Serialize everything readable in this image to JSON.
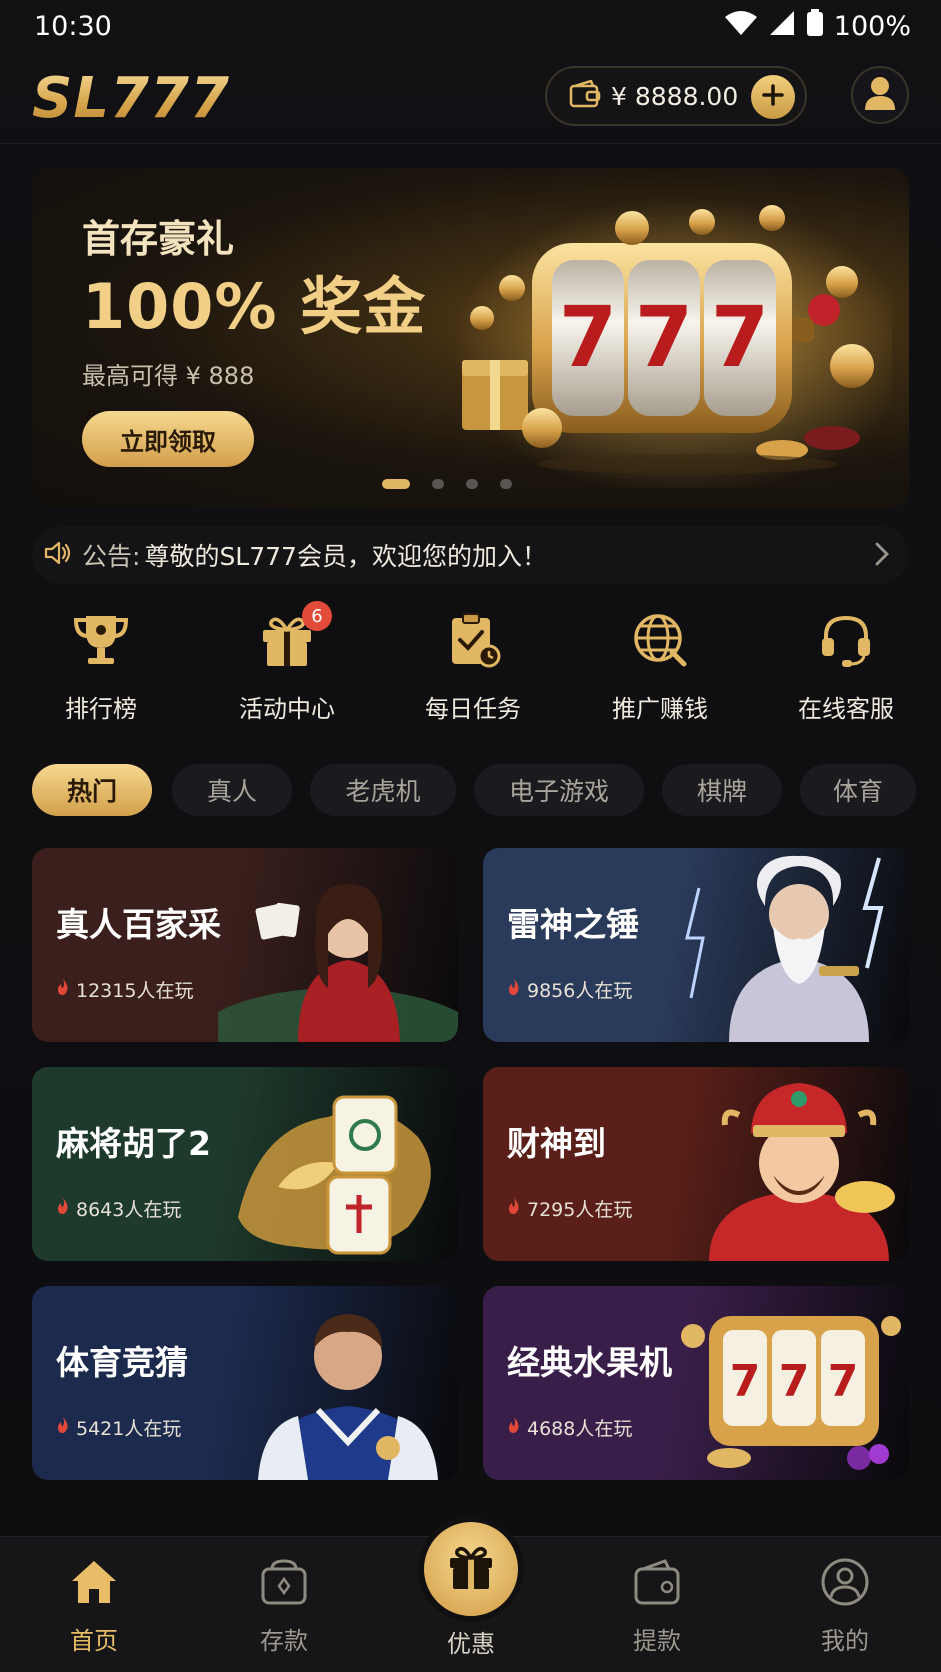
{
  "status_bar": {
    "time": "10:30",
    "battery": "100%"
  },
  "header": {
    "logo": "SL777",
    "balance": "¥ 8888.00"
  },
  "banner": {
    "subtitle": "首存豪礼",
    "headline": "100% 奖金",
    "note": "最高可得 ¥ 888",
    "button": "立即领取",
    "reel_digits": [
      "7",
      "7",
      "7"
    ],
    "slides_total": 4,
    "slide_active": 1
  },
  "notice": {
    "label": "公告:",
    "text": "尊敬的SL777会员，欢迎您的加入！"
  },
  "quick_menu": [
    {
      "label": "排行榜",
      "icon": "trophy-icon"
    },
    {
      "label": "活动中心",
      "icon": "gift-icon",
      "badge": "6"
    },
    {
      "label": "每日任务",
      "icon": "clipboard-check-icon"
    },
    {
      "label": "推广赚钱",
      "icon": "globe-icon"
    },
    {
      "label": "在线客服",
      "icon": "headset-icon"
    }
  ],
  "tabs": [
    "热门",
    "真人",
    "老虎机",
    "电子游戏",
    "棋牌",
    "体育"
  ],
  "active_tab": "热门",
  "games": [
    {
      "title": "真人百家采",
      "players": "12315人在玩",
      "color": "#3a1f1c"
    },
    {
      "title": "雷神之锤",
      "players": "9856人在玩",
      "color": "#2a3a5a"
    },
    {
      "title": "麻将胡了2",
      "players": "8643人在玩",
      "color": "#1e3a2c"
    },
    {
      "title": "财神到",
      "players": "7295人在玩",
      "color": "#5a1f18"
    },
    {
      "title": "体育竞猜",
      "players": "5421人在玩",
      "color": "#1c2a4e"
    },
    {
      "title": "经典水果机",
      "players": "4688人在玩",
      "color": "#3a1e4a"
    }
  ],
  "bottom_nav": [
    {
      "label": "首页",
      "icon": "home-icon",
      "active": true
    },
    {
      "label": "存款",
      "icon": "deposit-icon"
    },
    {
      "label": "优惠",
      "icon": "gift-icon"
    },
    {
      "label": "提款",
      "icon": "withdraw-icon"
    },
    {
      "label": "我的",
      "icon": "user-icon"
    }
  ],
  "colors": {
    "gold": "#e2b763",
    "background": "#0e0e11",
    "badge": "#e24a3a"
  }
}
